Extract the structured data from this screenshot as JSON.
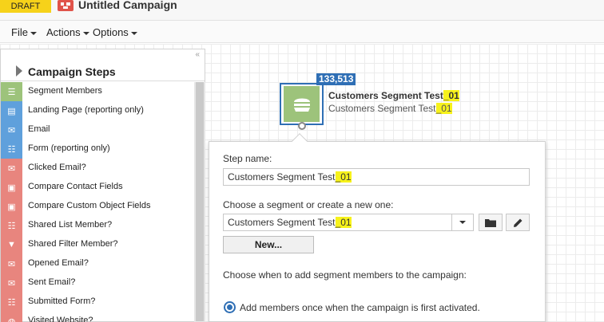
{
  "header": {
    "draft_badge": "DRAFT",
    "campaign_title": "Untitled Campaign"
  },
  "menu": {
    "file": "File",
    "actions": "Actions",
    "options": "Options"
  },
  "panel": {
    "collapse_symbol": "«",
    "title": "Campaign Steps",
    "items": [
      {
        "label": "Segment Members",
        "color": "#9dc37b",
        "icon": "segment-icon"
      },
      {
        "label": "Landing Page (reporting only)",
        "color": "#5fa0dc",
        "icon": "landing-page-icon"
      },
      {
        "label": "Email",
        "color": "#5fa0dc",
        "icon": "email-icon"
      },
      {
        "label": "Form (reporting only)",
        "color": "#5fa0dc",
        "icon": "form-icon"
      },
      {
        "label": "Clicked Email?",
        "color": "#e8857e",
        "icon": "clicked-email-icon"
      },
      {
        "label": "Compare Contact Fields",
        "color": "#e8857e",
        "icon": "compare-contact-icon"
      },
      {
        "label": "Compare Custom Object Fields",
        "color": "#e8857e",
        "icon": "compare-object-icon"
      },
      {
        "label": "Shared List Member?",
        "color": "#e8857e",
        "icon": "shared-list-icon"
      },
      {
        "label": "Shared Filter Member?",
        "color": "#e8857e",
        "icon": "filter-icon"
      },
      {
        "label": "Opened Email?",
        "color": "#e8857e",
        "icon": "opened-email-icon"
      },
      {
        "label": "Sent Email?",
        "color": "#e8857e",
        "icon": "sent-email-icon"
      },
      {
        "label": "Submitted Form?",
        "color": "#e8857e",
        "icon": "submitted-form-icon"
      },
      {
        "label": "Visited Website?",
        "color": "#e8857e",
        "icon": "visited-website-icon"
      }
    ]
  },
  "node": {
    "count": "133,513",
    "title_base": "Customers Segment Test",
    "title_suffix": "_01",
    "subtitle_base": "Customers Segment Test",
    "subtitle_suffix": "_01"
  },
  "popover": {
    "step_name_label": "Step name:",
    "step_name_base": "Customers Segment Test",
    "step_name_suffix": "_01",
    "segment_label": "Choose a segment or create a new one:",
    "segment_base": "Customers Segment Test",
    "segment_suffix": "_01",
    "new_button": "New...",
    "when_label": "Choose when to add segment members to the campaign:",
    "radio_option": "Add members once when the campaign is first activated."
  },
  "colors": {
    "accent": "#2f6fb5",
    "draft": "#f6d21a",
    "highlight": "#f7f21b"
  }
}
